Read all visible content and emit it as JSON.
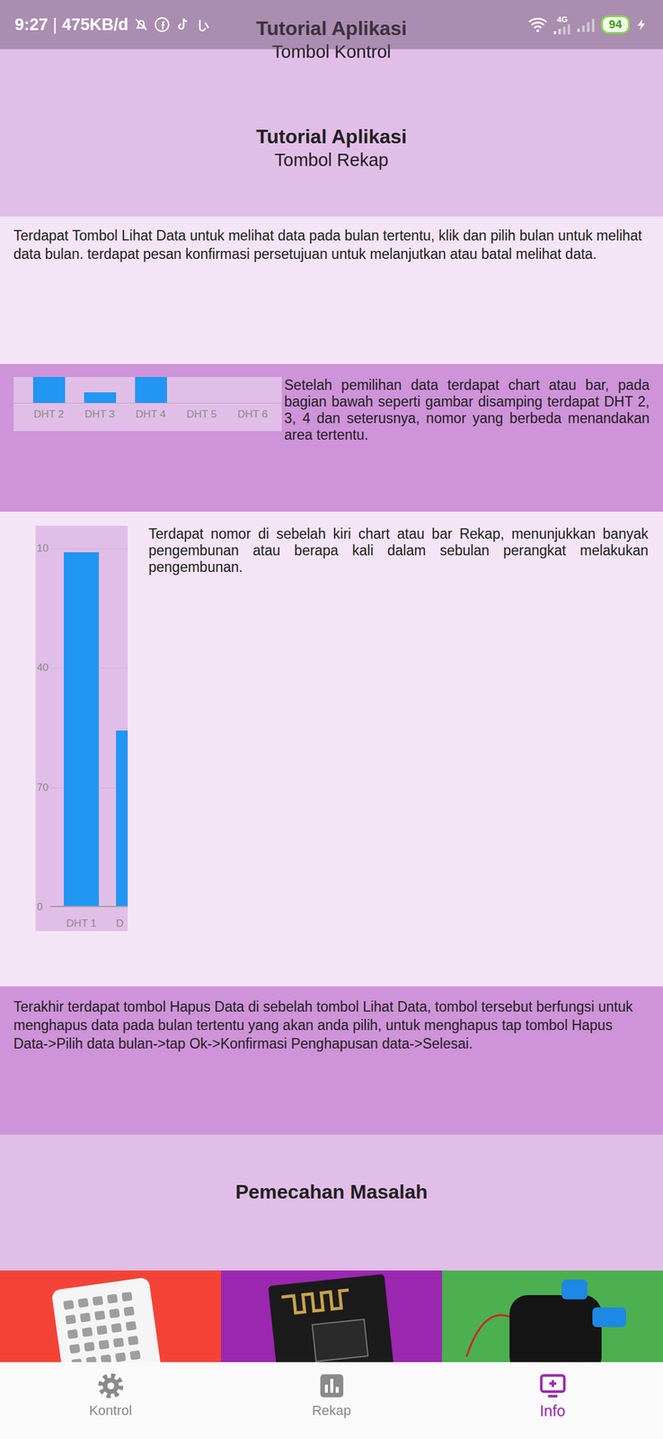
{
  "status_bar": {
    "time": "9:27",
    "separator": "|",
    "speed": "475KB/d",
    "network": "4G",
    "battery": "94"
  },
  "tutorial_headers": [
    {
      "title": "Tutorial Aplikasi",
      "subtitle": "Tombol Kontrol"
    },
    {
      "title": "Tutorial Aplikasi",
      "subtitle": "Tombol Rekap"
    }
  ],
  "intro": "Terdapat Tombol Lihat Data untuk melihat data pada bulan tertentu, klik dan pilih bulan untuk melihat data bulan. terdapat pesan konfirmasi persetujuan untuk melanjutkan atau batal melihat data.",
  "area_chart_row": {
    "text": "Setelah pemilihan data terdapat chart atau bar, pada bagian bawah seperti gambar disamping terdapat DHT 2, 3, 4 dan seterusnya, nomor yang berbeda menandakan area tertentu.",
    "chart": {
      "labels": [
        "DHT 2",
        "DHT 3",
        "DHT 4",
        "DHT 5",
        "DHT 6"
      ],
      "values": [
        100,
        40,
        100,
        0,
        0
      ],
      "max": 100
    }
  },
  "count_chart_row": {
    "text": "Terdapat nomor di sebelah kiri chart atau bar Rekap, menunjukkan banyak pengembunan atau berapa kali dalam sebulan perangkat melakukan pengembunan.",
    "chart": {
      "ticks": [
        "10",
        "40",
        "70",
        "0"
      ],
      "labels": [
        "DHT 1",
        "D"
      ],
      "values": [
        208,
        103
      ],
      "max": 210
    }
  },
  "delete_text": "Terakhir terdapat tombol Hapus Data di sebelah tombol Lihat Data, tombol tersebut berfungsi untuk menghapus data pada bulan tertentu yang akan anda pilih, untuk menghapus tap tombol Hapus Data->Pilih data bulan->tap Ok->Konfirmasi Penghapusan data->Selesai.",
  "troubleshooting_title": "Pemecahan Masalah",
  "troubleshooting_items": [
    {
      "kind": "sensor",
      "color": "#f44336"
    },
    {
      "kind": "board",
      "color": "#9c27b0"
    },
    {
      "kind": "pump",
      "color": "#4caf50"
    }
  ],
  "bottom_nav": [
    {
      "label": "Kontrol",
      "selected": false
    },
    {
      "label": "Rekap",
      "selected": false
    },
    {
      "label": "Info",
      "selected": true
    }
  ]
}
